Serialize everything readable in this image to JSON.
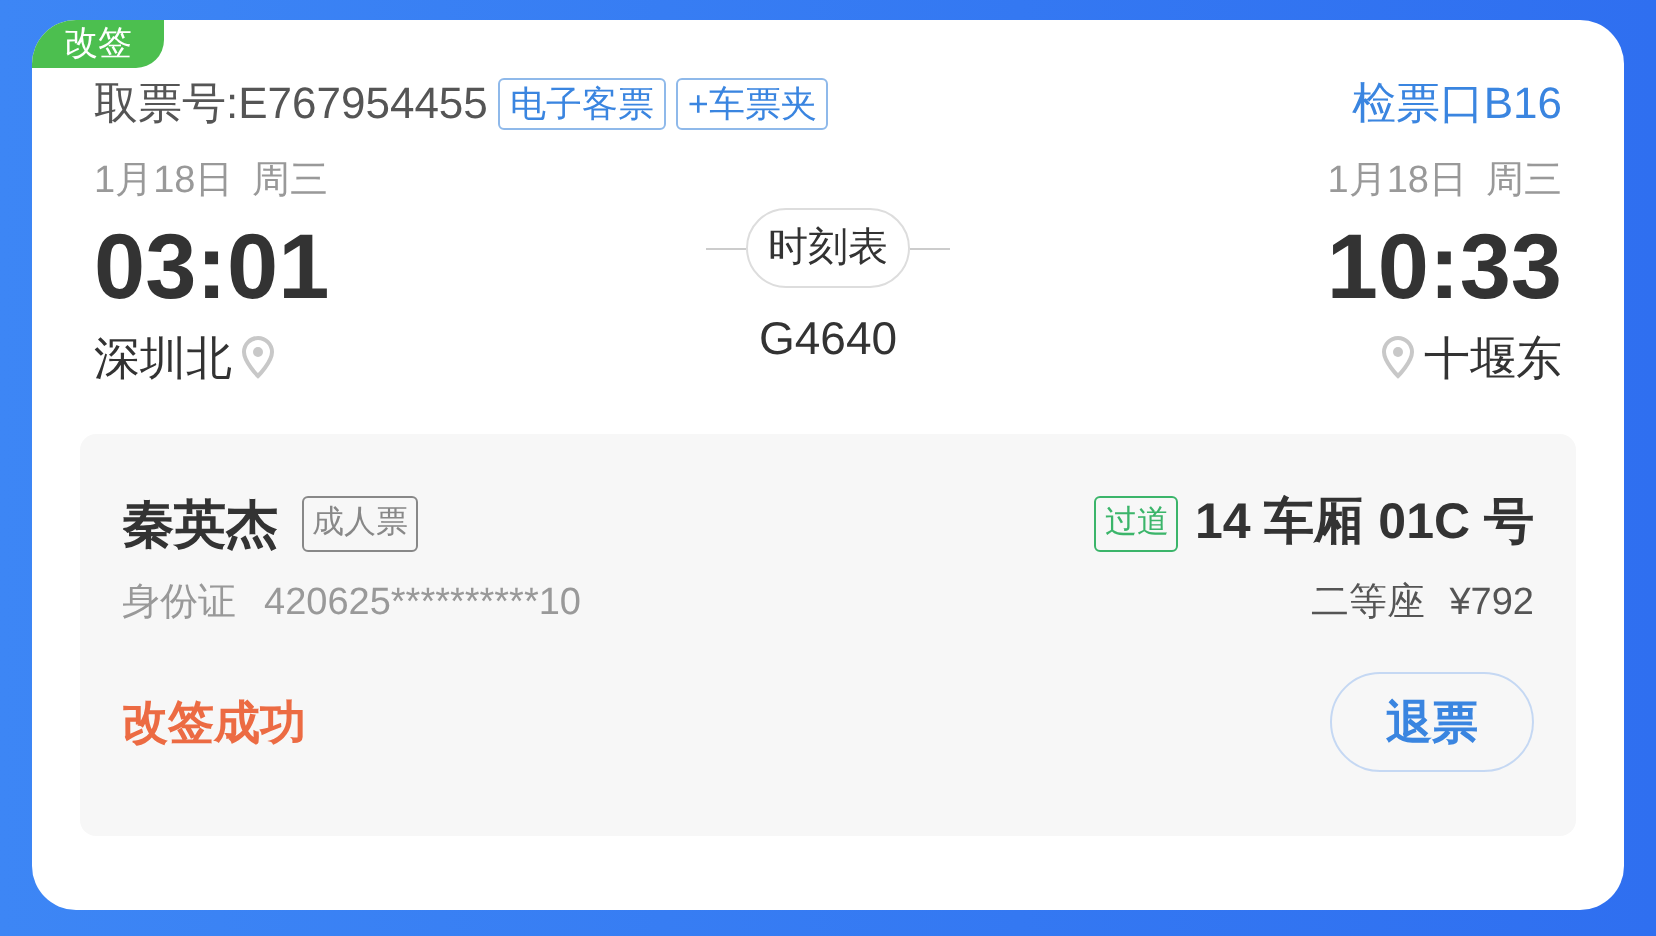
{
  "badge": "改签",
  "ticket": {
    "pickup_code": "取票号:E767954455",
    "tags": [
      "电子客票",
      "+车票夹"
    ],
    "gate": "检票口B16"
  },
  "departure": {
    "date": "1月18日",
    "weekday": "周三",
    "time": "03:01",
    "station": "深圳北"
  },
  "arrival": {
    "date": "1月18日",
    "weekday": "周三",
    "time": "10:33",
    "station": "十堰东"
  },
  "schedule_button": "时刻表",
  "train_number": "G4640",
  "passenger": {
    "name": "秦英杰",
    "ticket_type": "成人票",
    "seat_tag": "过道",
    "seat": "14 车厢 01C 号",
    "id_label": "身份证",
    "id_number": "420625**********10",
    "seat_class": "二等座",
    "price": "¥792",
    "status": "改签成功",
    "refund_button": "退票"
  }
}
